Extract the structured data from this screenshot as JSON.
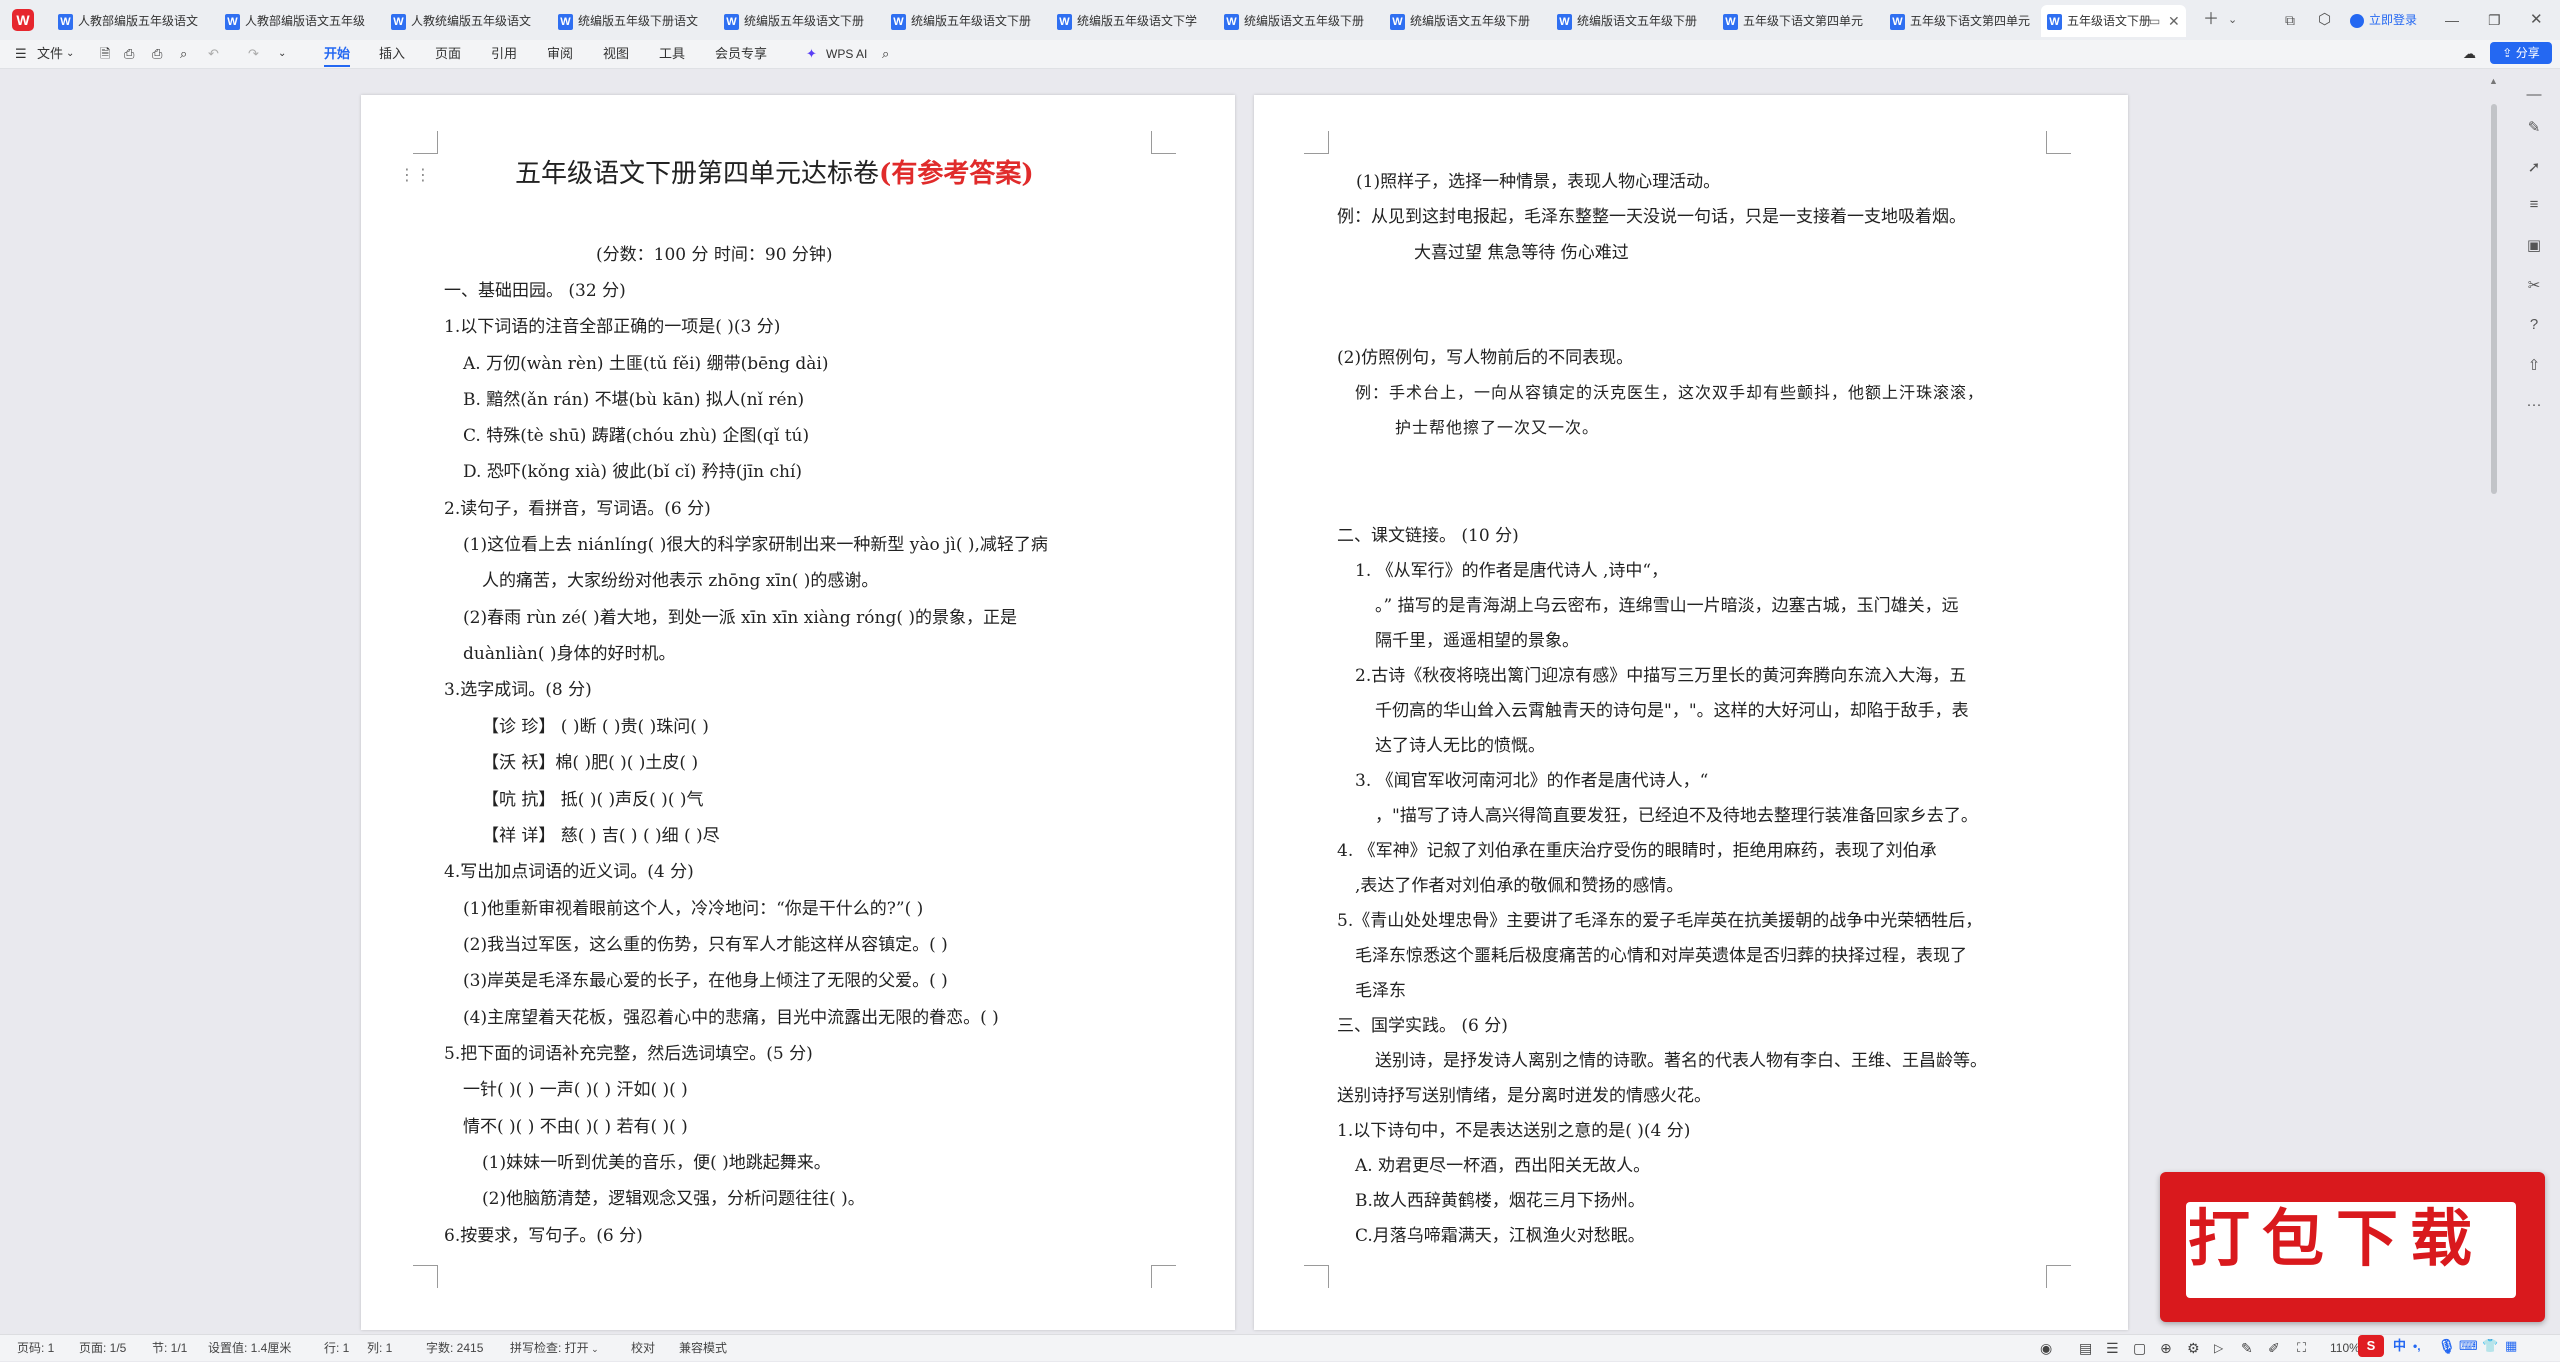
{
  "tabs": [
    {
      "label": "人教部编版五年级语文"
    },
    {
      "label": "人教部编版语文五年级"
    },
    {
      "label": "人教统编版五年级语文"
    },
    {
      "label": "统编版五年级下册语文"
    },
    {
      "label": "统编版五年级语文下册"
    },
    {
      "label": "统编版五年级语文下册"
    },
    {
      "label": "统编版五年级语文下学"
    },
    {
      "label": "统编版语文五年级下册"
    },
    {
      "label": "统编版语文五年级下册"
    },
    {
      "label": "统编版语文五年级下册"
    },
    {
      "label": "五年级下语文第四单元"
    },
    {
      "label": "五年级下语文第四单元"
    },
    {
      "label": "五年级语文下册"
    }
  ],
  "titlebar": {
    "login": "立即登录"
  },
  "ribbon": {
    "file": "文件",
    "menus": [
      "开始",
      "插入",
      "页面",
      "引用",
      "审阅",
      "视图",
      "工具",
      "会员专享"
    ],
    "wps_ai": "WPS AI",
    "share": "分享"
  },
  "doc": {
    "title_main": "五年级语文下册第四单元达标卷",
    "title_red": "(有参考答案)",
    "page1_lines": [
      "(分数：100 分        时间：90 分钟)",
      "一、基础田园。 (32 分)",
      "1.以下词语的注音全部正确的一项是(    )(3 分)",
      "A.  万仞(wàn    rèn)   土匪(tǔ fěi) 绷带(bēng    dài)",
      "B.  黯然(ǎn rán)  不堪(bù    kān) 拟人(nǐ rén)",
      "C.  特殊(tè    shū)     踌躇(chóu zhù) 企图(qǐ tú)",
      "D.  恐吓(kǒng    xià)  彼此(bǐ    cǐ)     矜持(jīn chí)",
      "2.读句子，看拼音，写词语。(6 分)",
      "(1)这位看上去 niánlíng(      )很大的科学家研制出来一种新型 yào jì(      ),减轻了病",
      "人的痛苦，大家纷纷对他表示 zhōng xīn(      )的感谢。",
      "(2)春雨  rùn    zé(      )着大地，到处一派 xīn xīn    xiàng róng(      )的景象，正是",
      "duànliàn(      )身体的好时机。",
      "3.选字成词。(8 分)",
      "【诊  珍】  (      )断  (      )贵(      )珠问(      )",
      "【沃  袄】棉(      )肥(      )(      )土皮(      )",
      "【吭  抗】  抵(      )(      )声反(      )(      )气",
      "【祥  详】  慈(      )    吉(      )    (      )细    (      )尽",
      "4.写出加点词语的近义词。(4 分)",
      "(1)他重新审视着眼前这个人，冷冷地问：“你是干什么的?”(      )",
      "(2)我当过军医，这么重的伤势，只有军人才能这样从容镇定。(      )",
      "(3)岸英是毛泽东最心爱的长子，在他身上倾注了无限的父爱。(      )",
      "(4)主席望着天花板，强忍着心中的悲痛，目光中流露出无限的眷恋。(      )",
      "5.把下面的词语补充完整，然后选词填空。(5 分)",
      "一针(      )(      )          一声(      )(      )          汗如(      )(      )",
      "情不(      )(      )          不由(      )(      )          若有(      )(      )",
      "(1)妹妹一听到优美的音乐，便(            )地跳起舞来。",
      "(2)他脑筋清楚，逻辑观念又强，分析问题往往(            )。",
      "6.按要求，写句子。(6 分)"
    ],
    "page2_lines": [
      "(1)照样子，选择一种情景，表现人物心理活动。",
      "例：从见到这封电报起，毛泽东整整一天没说一句话，只是一支接着一支地吸着烟。",
      "大喜过望           焦急等待           伤心难过",
      "(2)仿照例句，写人物前后的不同表现。",
      "例：手术台上，一向从容镇定的沃克医生，这次双手却有些颤抖，他额上汗珠滚滚，",
      "护士帮他擦了一次又一次。",
      "二、课文链接。 (10 分)",
      "1.  《从军行》的作者是唐代诗人  ,诗中“，",
      "。”  描写的是青海湖上乌云密布，连绵雪山一片暗淡，边塞古城，玉门雄关，远",
      "隔千里，遥遥相望的景象。",
      "2.古诗《秋夜将晓出篱门迎凉有感》中描写三万里长的黄河奔腾向东流入大海，五",
      "千仞高的华山耸入云霄触青天的诗句是\"，\"。这样的大好河山，却陷于敌手，表",
      "达了诗人无比的愤慨。",
      "3.  《闻官军收河南河北》的作者是唐代诗人，“",
      "，\"描写了诗人高兴得简直要发狂，已经迫不及待地去整理行装准备回家乡去了。",
      "4.  《军神》记叙了刘伯承在重庆治疗受伤的眼睛时，拒绝用麻药，表现了刘伯承",
      ",表达了作者对刘伯承的敬佩和赞扬的感情。",
      "5.《青山处处埋忠骨》主要讲了毛泽东的爱子毛岸英在抗美援朝的战争中光荣牺牲后，",
      "毛泽东惊悉这个噩耗后极度痛苦的心情和对岸英遗体是否归葬的抉择过程，表现了",
      "毛泽东",
      "三、国学实践。 (6 分)",
      "送别诗，是抒发诗人离别之情的诗歌。著名的代表人物有李白、王维、王昌龄等。",
      "送别诗抒写送别情绪，是分离时迸发的情感火花。",
      "1.以下诗句中，不是表达送别之意的是(      )(4 分)",
      "A.  劝君更尽一杯酒，西出阳关无故人。",
      "B.故人西辞黄鹤楼，烟花三月下扬州。",
      "C.月落乌啼霜满天，江枫渔火对愁眠。"
    ]
  },
  "status": {
    "page": "页码: 1",
    "pages": "页面: 1/5",
    "section": "节: 1/1",
    "setting": "设置值: 1.4厘米",
    "row": "行: 1",
    "col": "列: 1",
    "words": "字数: 2415",
    "spell": "拼写检查: 打开",
    "proof": "校对",
    "compat": "兼容模式",
    "zoom": "110%"
  },
  "badge": {
    "text": "打包下载"
  },
  "ime": {
    "lang": "中"
  }
}
